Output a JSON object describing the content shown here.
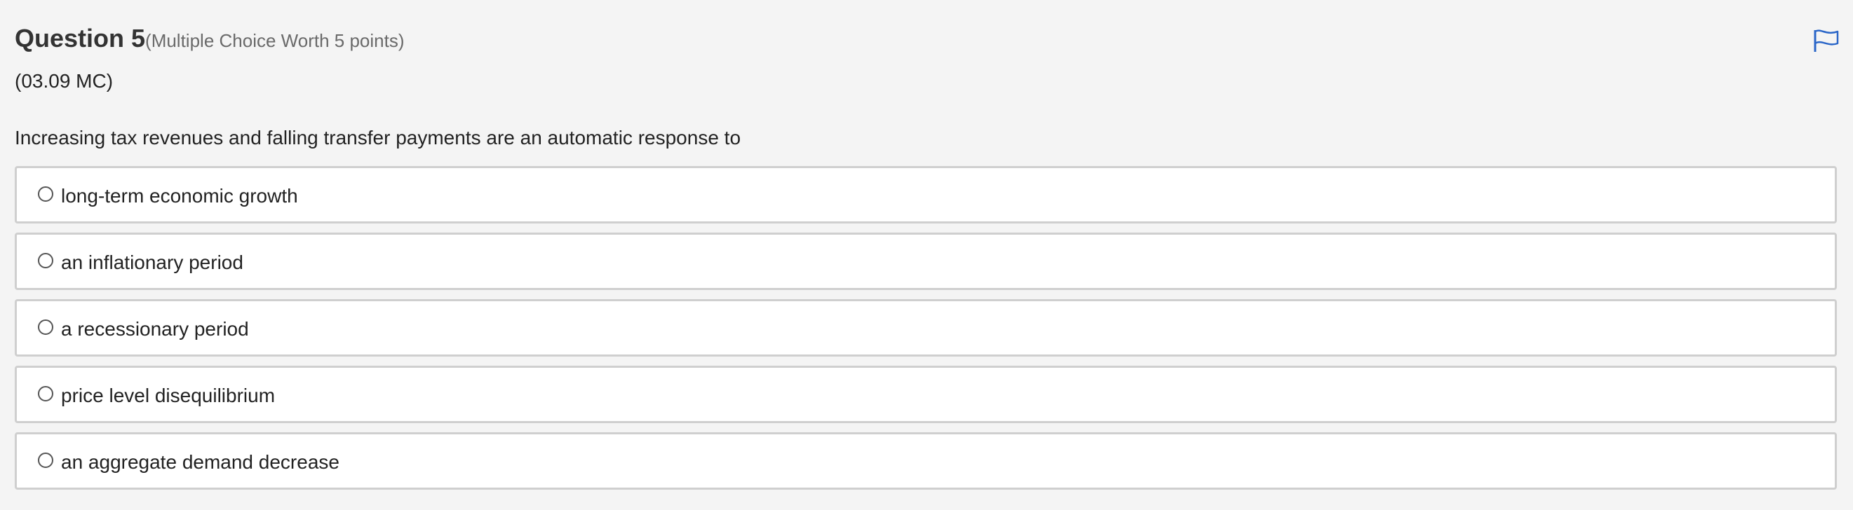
{
  "question": {
    "title": "Question 5",
    "worth": "(Multiple Choice Worth 5 points)",
    "code": "(03.09 MC)",
    "prompt": "Increasing tax revenues and falling transfer payments are an automatic response to"
  },
  "flag": {
    "icon": "flag-icon",
    "color": "#2a66c8"
  },
  "options": [
    {
      "label": "long-term economic growth"
    },
    {
      "label": "an inflationary period"
    },
    {
      "label": "a recessionary period"
    },
    {
      "label": "price level disequilibrium"
    },
    {
      "label": "an aggregate demand decrease"
    }
  ]
}
